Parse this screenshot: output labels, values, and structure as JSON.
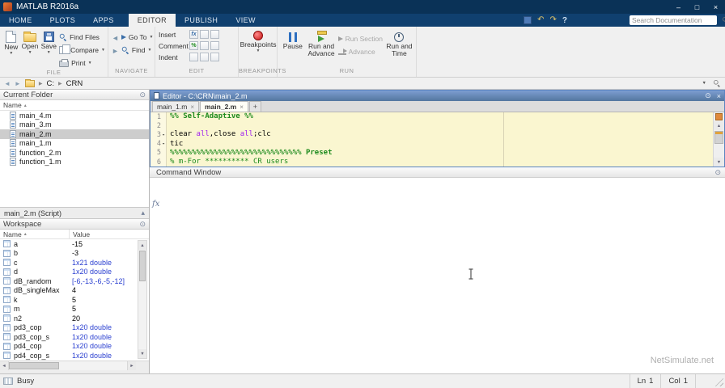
{
  "colors": {
    "brand_blue": "#0a3257",
    "ribbon_tab_bg": "#10406f",
    "panel_header_blue": "#53769f",
    "comment_green": "#1e8b1e",
    "command_string_purple": "#a020f0",
    "section_highlight_yellow": "#faf6d0",
    "selected_row_gray": "#cdcdcd"
  },
  "icons": {
    "minimize": "–",
    "maximize": "□",
    "close_x": "×",
    "question": "?",
    "undo": "↶",
    "redo": "↷",
    "caret_down": "▼",
    "panel_menu": "⊙",
    "close_small": "×",
    "sort_asc": "▴",
    "collapse": "▴",
    "crumb_sep": "▶",
    "back": "◄",
    "forward": "►",
    "scroll_up": "▲",
    "scroll_down": "▼",
    "scroll_left": "◄",
    "scroll_right": "►",
    "plus": "+",
    "fx": "fx",
    "percent": "%"
  },
  "titlebar": {
    "title": "MATLAB R2016a"
  },
  "ribbon": {
    "tabs": [
      {
        "id": "home",
        "label": "HOME",
        "active": false
      },
      {
        "id": "plots",
        "label": "PLOTS",
        "active": false
      },
      {
        "id": "apps",
        "label": "APPS",
        "active": false
      },
      {
        "id": "editor",
        "label": "EDITOR",
        "active": true
      },
      {
        "id": "publish",
        "label": "PUBLISH",
        "active": false
      },
      {
        "id": "view",
        "label": "VIEW",
        "active": false
      }
    ],
    "search": {
      "placeholder": "Search Documentation"
    },
    "sections": {
      "file": {
        "label": "FILE",
        "new_label": "New",
        "open_label": "Open",
        "save_label": "Save",
        "find_files_label": "Find Files",
        "compare_label": "Compare",
        "print_label": "Print"
      },
      "navigate": {
        "label": "NAVIGATE",
        "goto_label": "Go To",
        "find_label": "Find"
      },
      "edit": {
        "label": "EDIT",
        "insert_label": "Insert",
        "comment_label": "Comment",
        "indent_label": "Indent"
      },
      "breakpoints": {
        "label": "BREAKPOINTS",
        "button_label": "Breakpoints"
      },
      "run": {
        "label": "RUN",
        "pause_label": "Pause",
        "run_advance_1": "Run and",
        "run_advance_2": "Advance",
        "run_section_label": "Run Section",
        "advance_label": "Advance",
        "run_time_1": "Run and",
        "run_time_2": "Time"
      }
    }
  },
  "addressbar": {
    "breadcrumb": [
      {
        "label": "C:"
      },
      {
        "label": "CRN"
      }
    ]
  },
  "current_folder": {
    "title": "Current Folder",
    "column": "Name",
    "files": [
      {
        "name": "main_4.m",
        "selected": false
      },
      {
        "name": "main_3.m",
        "selected": false
      },
      {
        "name": "main_2.m",
        "selected": true
      },
      {
        "name": "main_1.m",
        "selected": false
      },
      {
        "name": "function_2.m",
        "selected": false
      },
      {
        "name": "function_1.m",
        "selected": false
      }
    ]
  },
  "details": {
    "label": "main_2.m (Script)"
  },
  "workspace": {
    "title": "Workspace",
    "columns": {
      "name": "Name",
      "value": "Value"
    },
    "rows": [
      {
        "name": "a",
        "value": "-15",
        "kind": "plain"
      },
      {
        "name": "b",
        "value": "-3",
        "kind": "plain"
      },
      {
        "name": "c",
        "value": "1x21 double",
        "kind": "summary"
      },
      {
        "name": "d",
        "value": "1x20 double",
        "kind": "summary"
      },
      {
        "name": "dB_random",
        "value": "[-6,-13,-6,-5,-12]",
        "kind": "summary"
      },
      {
        "name": "dB_singleMax",
        "value": "4",
        "kind": "plain"
      },
      {
        "name": "k",
        "value": "5",
        "kind": "plain"
      },
      {
        "name": "m",
        "value": "5",
        "kind": "plain"
      },
      {
        "name": "n2",
        "value": "20",
        "kind": "plain"
      },
      {
        "name": "pd3_cop",
        "value": "1x20 double",
        "kind": "summary"
      },
      {
        "name": "pd3_cop_s",
        "value": "1x20 double",
        "kind": "summary"
      },
      {
        "name": "pd4_cop",
        "value": "1x20 double",
        "kind": "summary"
      },
      {
        "name": "pd4_cop_s",
        "value": "1x20 double",
        "kind": "summary"
      }
    ]
  },
  "editor": {
    "title": "Editor - C:\\CRN\\main_2.m",
    "tabs": [
      {
        "label": "main_1.m",
        "active": false
      },
      {
        "label": "main_2.m",
        "active": true
      }
    ],
    "code": [
      {
        "n": "1",
        "dash": "",
        "tokens": [
          {
            "t": "%% Self-Adaptive %%",
            "c": "section"
          }
        ]
      },
      {
        "n": "2",
        "dash": "",
        "tokens": []
      },
      {
        "n": "3",
        "dash": "-",
        "tokens": [
          {
            "t": "clear ",
            "c": "plain"
          },
          {
            "t": "all",
            "c": "cmdstr"
          },
          {
            "t": ",",
            "c": "plain"
          },
          {
            "t": "close ",
            "c": "plain"
          },
          {
            "t": "all",
            "c": "cmdstr"
          },
          {
            "t": ";clc",
            "c": "plain"
          }
        ]
      },
      {
        "n": "4",
        "dash": "-",
        "tokens": [
          {
            "t": "tic",
            "c": "plain"
          }
        ]
      },
      {
        "n": "5",
        "dash": "",
        "tokens": [
          {
            "t": "%%%%%%%%%%%%%%%%%%%%%%%%%%%%%% Preset",
            "c": "section"
          }
        ]
      },
      {
        "n": "6",
        "dash": "",
        "tokens": [
          {
            "t": "% m-For ********** CR users",
            "c": "comment"
          }
        ]
      }
    ]
  },
  "command_window": {
    "title": "Command Window",
    "fx_label": "fx"
  },
  "watermark": "NetSimulate.net",
  "statusbar": {
    "busy": "Busy",
    "line_label": "Ln",
    "line_value": "1",
    "column_label": "Col",
    "column_value": "1"
  }
}
